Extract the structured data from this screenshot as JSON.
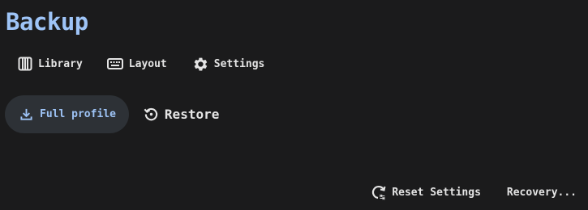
{
  "page": {
    "title": "Backup"
  },
  "nav": {
    "items": [
      {
        "label": "Library",
        "icon": "library-icon"
      },
      {
        "label": "Layout",
        "icon": "keyboard-icon"
      },
      {
        "label": "Settings",
        "icon": "gear-icon"
      }
    ]
  },
  "actions": {
    "full_profile_label": "Full profile",
    "full_profile_icon": "download-icon",
    "restore_label": "Restore",
    "restore_icon": "restore-icon"
  },
  "footer": {
    "reset_label": "Reset Settings",
    "reset_icon": "reset-settings-icon",
    "recovery_label": "Recovery..."
  },
  "colors": {
    "background": "#1b1b1c",
    "accent": "#9ec4f7",
    "pill_background": "#2d3136",
    "text": "#e6e6e6"
  }
}
